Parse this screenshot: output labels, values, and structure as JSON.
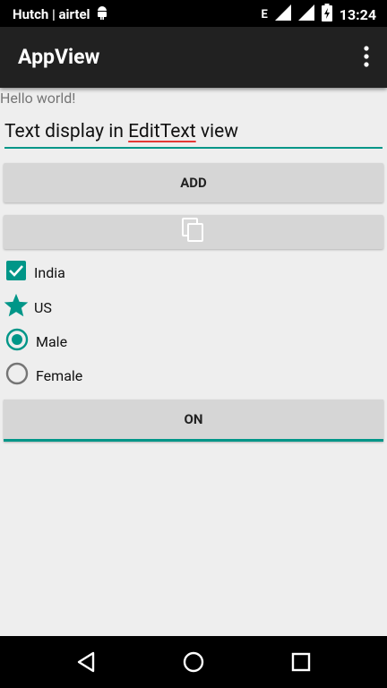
{
  "status": {
    "carrier": "Hutch | airtel",
    "network": "E",
    "time": "13:24"
  },
  "app": {
    "title": "AppView"
  },
  "content": {
    "hello": "Hello world!",
    "edit_text_prefix": "Text display in ",
    "edit_text_misspelled": "EditText",
    "edit_text_suffix": " view",
    "add_button": "ADD",
    "checkbox_india": "India",
    "star_us": "US",
    "radio_male": "Male",
    "radio_female": "Female",
    "toggle_label": "ON"
  },
  "colors": {
    "accent": "#009688",
    "button_bg": "#d6d6d6",
    "background": "#eeeeee"
  },
  "icons": {
    "copy_button": "copy-icon",
    "nav_back": "back-icon",
    "nav_home": "home-icon",
    "nav_recents": "recents-icon"
  }
}
